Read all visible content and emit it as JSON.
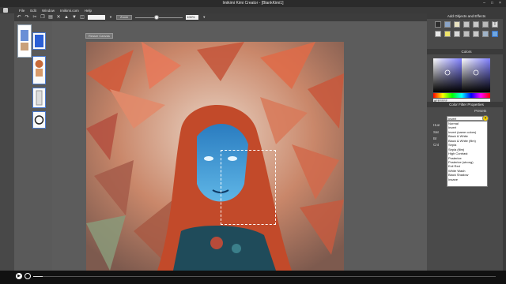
{
  "window": {
    "title": "Imikimi Kimi Creator - [BlankKimi1]",
    "minimize": "–",
    "maximize": "□",
    "close": "×"
  },
  "menu": [
    "File",
    "Edit",
    "Window",
    "Imikimi.com",
    "Help"
  ],
  "toolbar": {
    "zoom_input": "",
    "zoom_button": "Zoom",
    "zoom_percent": "100%",
    "zoom_level": 0.4
  },
  "canvas": {
    "resize_button": "Resize Canvas"
  },
  "right_panel": {
    "objects_header": "Add Objects and Effects",
    "colors_header": "Colors",
    "hex_value": "#FFFFFF",
    "filter_header": "Color Filter Properties",
    "presets_label": "Presets",
    "preset_selected": "Invert",
    "preset_options": [
      "Normal",
      "Invert",
      "Invert (same colors)",
      "Black & White",
      "Black & White (film)",
      "Sepia",
      "Sepia (film)",
      "High Contrast",
      "Posterize",
      "Posterize (strong)",
      "Evil Red",
      "White Wash",
      "Black Shadow",
      "Insane"
    ],
    "filter_labels": {
      "hue": "Hue",
      "sat": "Sat",
      "bri": "Br",
      "cnt": "Cnt"
    }
  },
  "player": {
    "progress": 0.02
  },
  "colors": {
    "accent": "#4a7ad0",
    "preset_arrow": "#f5d000"
  }
}
